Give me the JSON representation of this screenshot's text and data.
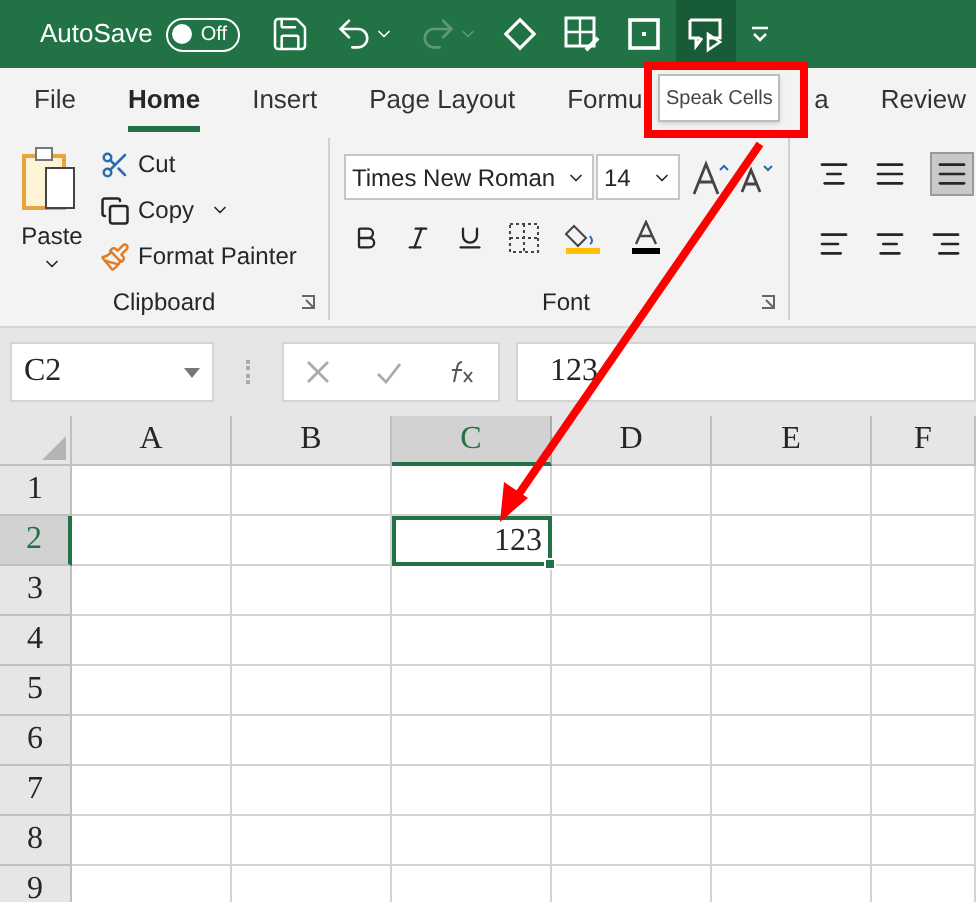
{
  "title_bar": {
    "autosave": {
      "label": "AutoSave",
      "toggle": "Off",
      "on": false
    },
    "quick_access": [
      {
        "kind": "save",
        "disabled": false,
        "hovered": false
      },
      {
        "kind": "undo",
        "disabled": false,
        "hovered": false
      },
      {
        "kind": "redo",
        "disabled": true,
        "hovered": false
      },
      {
        "kind": "eraser",
        "disabled": false,
        "hovered": false
      },
      {
        "kind": "form",
        "disabled": false,
        "hovered": false
      },
      {
        "kind": "square",
        "disabled": false,
        "hovered": false
      },
      {
        "kind": "speak",
        "disabled": false,
        "hovered": true
      },
      {
        "kind": "customize",
        "disabled": false,
        "hovered": false
      }
    ]
  },
  "tooltip": {
    "text": "Speak Cells"
  },
  "tabs": [
    {
      "label": "File",
      "selected": false
    },
    {
      "label": "Home",
      "selected": true
    },
    {
      "label": "Insert",
      "selected": false
    },
    {
      "label": "Page Layout",
      "selected": false
    },
    {
      "label": "Formu",
      "tail": "a",
      "selected": false
    },
    {
      "label": "Review",
      "selected": false
    }
  ],
  "ribbon": {
    "clipboard": {
      "paste": "Paste",
      "cut": "Cut",
      "copy": "Copy",
      "format_painter": "Format Painter",
      "label": "Clipboard"
    },
    "font": {
      "font_name": "Times New Roman",
      "font_size": "14",
      "label": "Font"
    }
  },
  "formula_bar": {
    "name_box": "C2",
    "formula": "123"
  },
  "sheet": {
    "columns": [
      {
        "label": "A",
        "selected": false
      },
      {
        "label": "B",
        "selected": false
      },
      {
        "label": "C",
        "selected": true
      },
      {
        "label": "D",
        "selected": false
      },
      {
        "label": "E",
        "selected": false
      },
      {
        "label": "F",
        "selected": false
      }
    ],
    "rows": [
      {
        "label": "1",
        "selected": false,
        "cells": []
      },
      {
        "label": "2",
        "selected": true,
        "cells": [
          null,
          null,
          {
            "value": "123",
            "selected": true
          }
        ]
      },
      {
        "label": "3",
        "selected": false,
        "cells": []
      },
      {
        "label": "4",
        "selected": false,
        "cells": []
      },
      {
        "label": "5",
        "selected": false,
        "cells": []
      },
      {
        "label": "6",
        "selected": false,
        "cells": []
      },
      {
        "label": "7",
        "selected": false,
        "cells": []
      },
      {
        "label": "8",
        "selected": false,
        "cells": []
      },
      {
        "label": "9",
        "selected": false,
        "cells": []
      }
    ]
  }
}
